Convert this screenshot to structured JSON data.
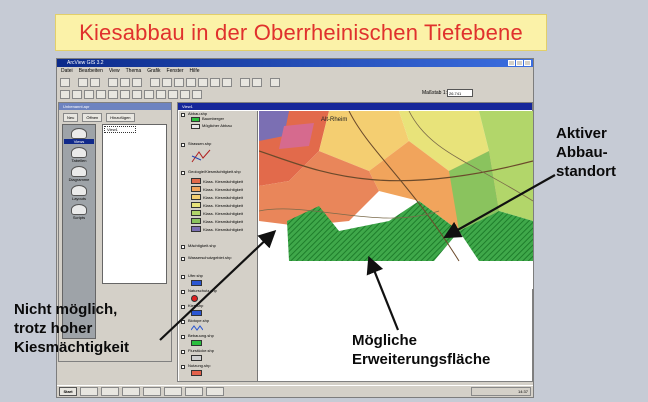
{
  "slide": {
    "title": "Kiesabbau in der Oberrheinischen Tiefebene"
  },
  "app": {
    "window_title": "ArcView GIS 3.2",
    "menus": [
      "Datei",
      "Bearbeiten",
      "View",
      "Thema",
      "Grafik",
      "Fenster",
      "Hilfe"
    ],
    "scale_label": "Maßstab 1:",
    "scale_value": "26.741",
    "project": {
      "title": "Unbenannt.apr",
      "buttons": [
        "Neu",
        "Öffnen",
        "Hinzufügen"
      ],
      "doc_types": [
        "Views",
        "Tabellen",
        "Diagramme",
        "Layouts",
        "Scripts"
      ],
      "selected_doc_type": "Views",
      "list_items": [
        "View1"
      ]
    },
    "view": {
      "title": "View1",
      "map_label": "Alt-Rheim",
      "legend": [
        {
          "name": "Abbau.shp",
          "sub": [
            "Baumberger",
            "Möglicher Abbau"
          ],
          "colors": [
            "#2bbf3e",
            "#e7e7e7"
          ]
        },
        {
          "name": "Strassen.shp",
          "sub": [],
          "colors": [
            "#ffffff"
          ]
        },
        {
          "name": "Geologie/Kiesmächtigkeit.shp",
          "sub": [
            "Klass. Kiesmächtigkeit"
          ],
          "colors": [
            "#e26a4b",
            "#f1a45c",
            "#f4ce71",
            "#e8e37a",
            "#b2d66a",
            "#8ac35e",
            "#7b6fb3"
          ]
        },
        {
          "name": "Mächtigkeit.shp",
          "sub": [],
          "colors": [
            "#2bbf3e"
          ]
        },
        {
          "name": "Wasserschutzgebiet.shp",
          "sub": [],
          "colors": [
            "#2b56d1"
          ]
        },
        {
          "name": "Ufer.shp",
          "sub": [],
          "colors": [
            "#2b56d1"
          ]
        },
        {
          "name": "Naturschutz.shp",
          "sub": [],
          "colors": [
            "#e02020"
          ]
        },
        {
          "name": "Kies.shp",
          "sub": [],
          "colors": [
            "#2b56d1"
          ]
        },
        {
          "name": "Biotope.shp",
          "sub": [],
          "colors": [
            "#2b56d1"
          ]
        },
        {
          "name": "Bebauung.shp",
          "sub": [],
          "colors": [
            "#2bbf3e"
          ]
        },
        {
          "name": "Flurstücke.shp",
          "sub": [],
          "colors": [
            "#d0d0d0"
          ]
        },
        {
          "name": "Nutzung.shp",
          "sub": [],
          "colors": [
            "#e2604a"
          ]
        }
      ]
    },
    "taskbar": {
      "start_label": "Start",
      "clock": "14:37"
    }
  },
  "callouts": {
    "active_site": "Aktiver\nAbbau-\nstandort",
    "not_possible": "Nicht möglich,\ntrotz hoher\nKiesmächtigkeit",
    "possible_area": "Mögliche\nErweiterungsfläche"
  },
  "colors": {
    "title_text": "#e0312d",
    "title_bg": "#fbf2a8",
    "hatch_green": "#2bbf3e"
  }
}
